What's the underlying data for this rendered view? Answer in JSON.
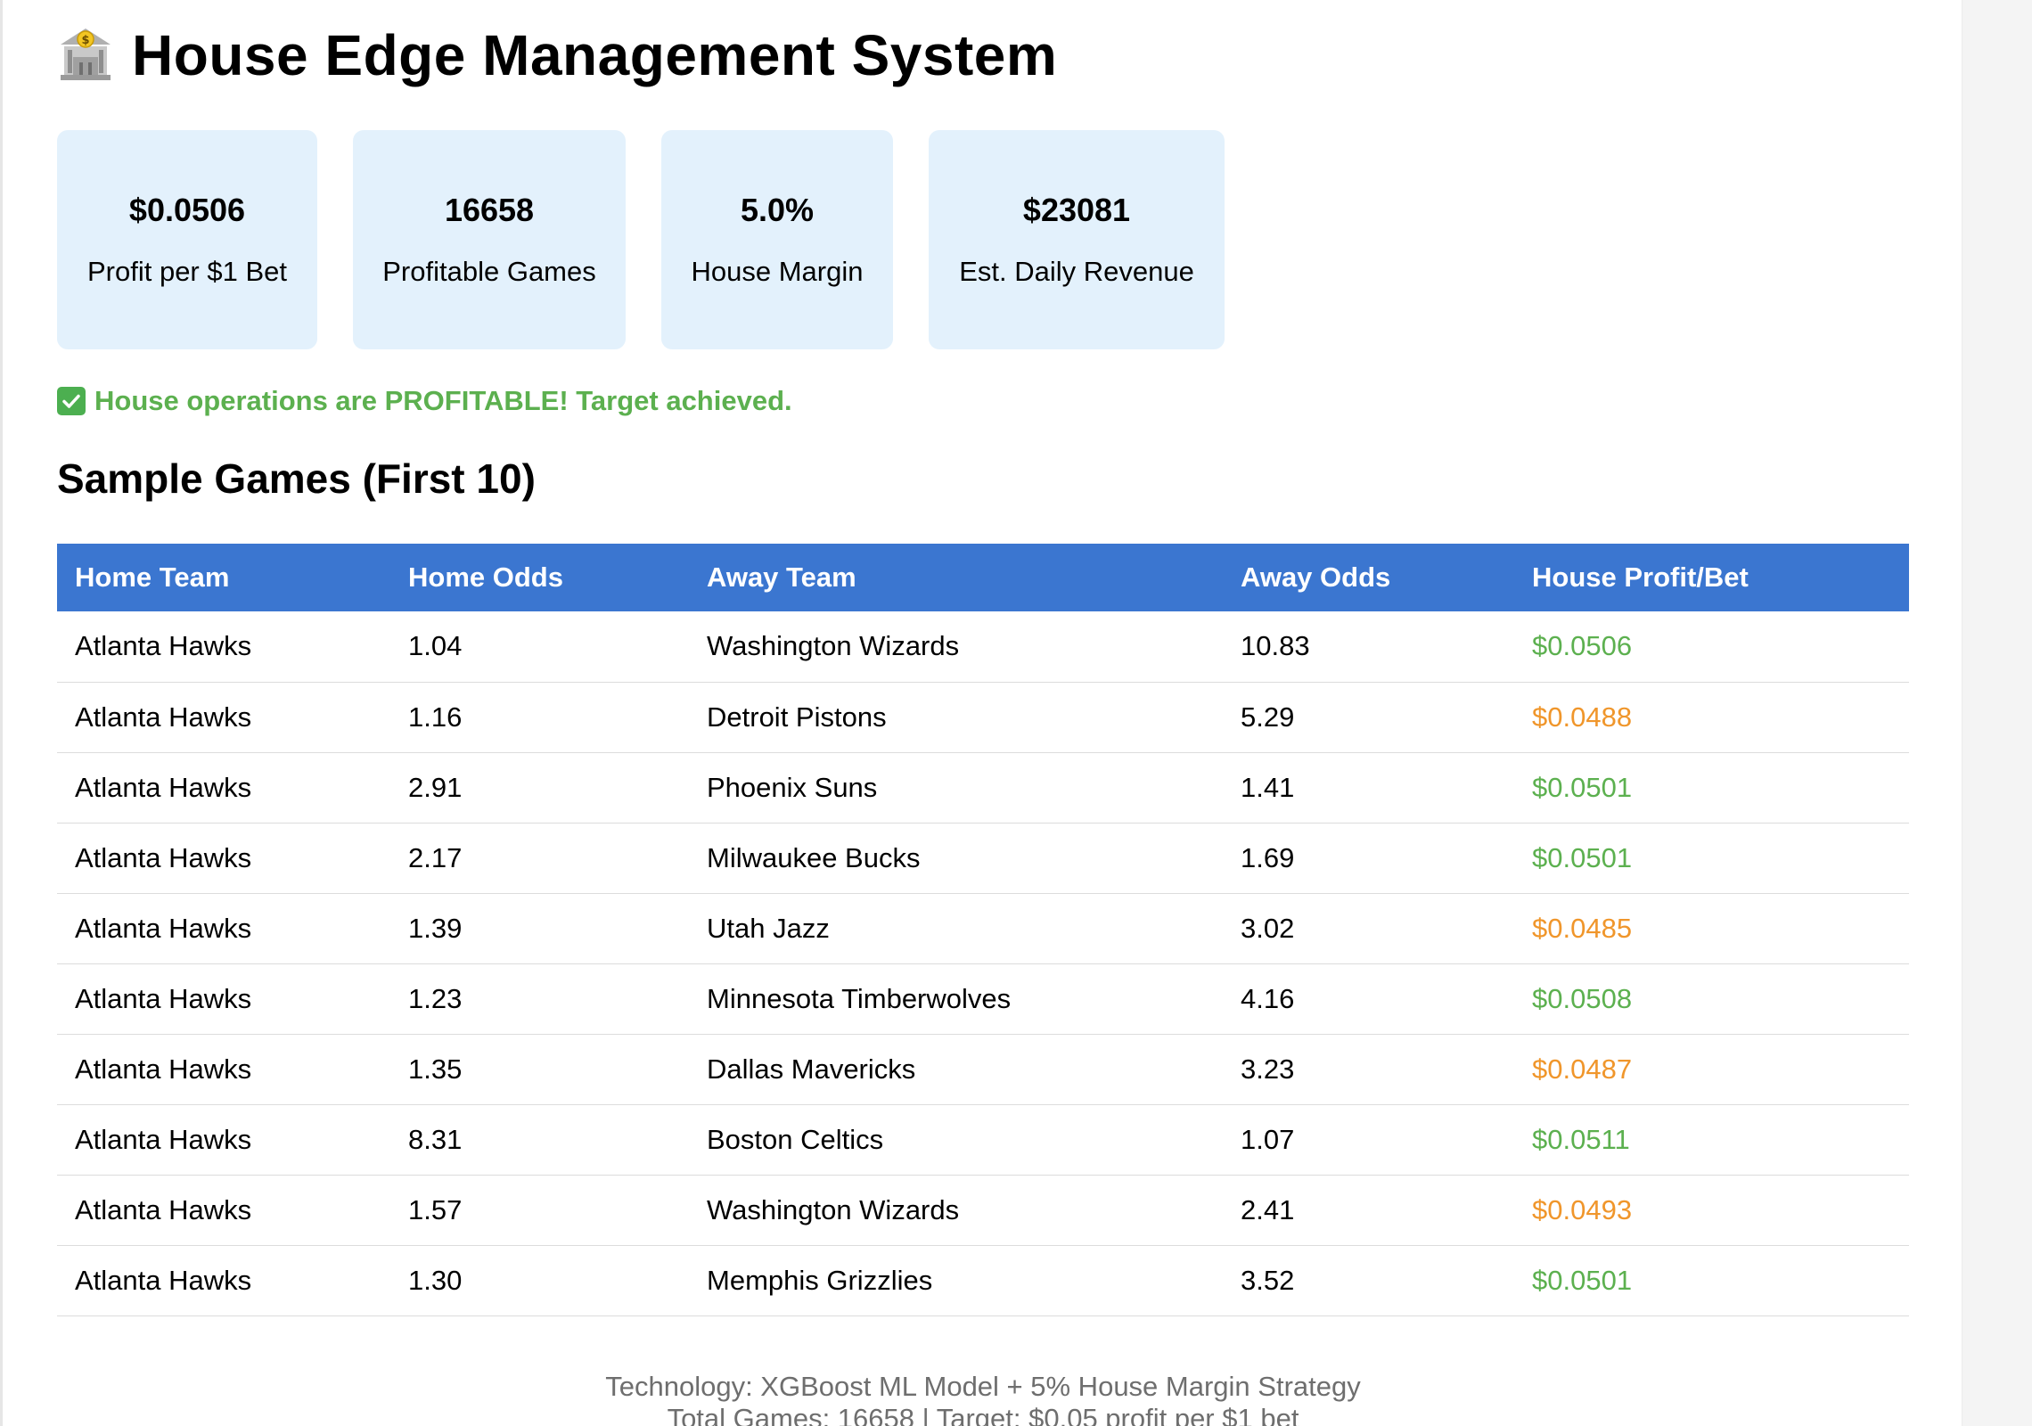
{
  "header": {
    "title": "House Edge Management System",
    "icon": "bank-icon"
  },
  "metrics": [
    {
      "value": "$0.0506",
      "label": "Profit per $1 Bet"
    },
    {
      "value": "16658",
      "label": "Profitable Games"
    },
    {
      "value": "5.0%",
      "label": "House Margin"
    },
    {
      "value": "$23081",
      "label": "Est. Daily Revenue"
    }
  ],
  "status": {
    "icon": "check-mark-icon",
    "text": "House operations are PROFITABLE! Target achieved.",
    "color": "#5cb04f"
  },
  "sample": {
    "title": "Sample Games (First 10)",
    "columns": [
      "Home Team",
      "Home Odds",
      "Away Team",
      "Away Odds",
      "House Profit/Bet"
    ],
    "rows": [
      {
        "home": "Atlanta Hawks",
        "home_odds": "1.04",
        "away": "Washington Wizards",
        "away_odds": "10.83",
        "profit": "$0.0506",
        "profit_status": "good"
      },
      {
        "home": "Atlanta Hawks",
        "home_odds": "1.16",
        "away": "Detroit Pistons",
        "away_odds": "5.29",
        "profit": "$0.0488",
        "profit_status": "warn"
      },
      {
        "home": "Atlanta Hawks",
        "home_odds": "2.91",
        "away": "Phoenix Suns",
        "away_odds": "1.41",
        "profit": "$0.0501",
        "profit_status": "good"
      },
      {
        "home": "Atlanta Hawks",
        "home_odds": "2.17",
        "away": "Milwaukee Bucks",
        "away_odds": "1.69",
        "profit": "$0.0501",
        "profit_status": "good"
      },
      {
        "home": "Atlanta Hawks",
        "home_odds": "1.39",
        "away": "Utah Jazz",
        "away_odds": "3.02",
        "profit": "$0.0485",
        "profit_status": "warn"
      },
      {
        "home": "Atlanta Hawks",
        "home_odds": "1.23",
        "away": "Minnesota Timberwolves",
        "away_odds": "4.16",
        "profit": "$0.0508",
        "profit_status": "good"
      },
      {
        "home": "Atlanta Hawks",
        "home_odds": "1.35",
        "away": "Dallas Mavericks",
        "away_odds": "3.23",
        "profit": "$0.0487",
        "profit_status": "warn"
      },
      {
        "home": "Atlanta Hawks",
        "home_odds": "8.31",
        "away": "Boston Celtics",
        "away_odds": "1.07",
        "profit": "$0.0511",
        "profit_status": "good"
      },
      {
        "home": "Atlanta Hawks",
        "home_odds": "1.57",
        "away": "Washington Wizards",
        "away_odds": "2.41",
        "profit": "$0.0493",
        "profit_status": "warn"
      },
      {
        "home": "Atlanta Hawks",
        "home_odds": "1.30",
        "away": "Memphis Grizzlies",
        "away_odds": "3.52",
        "profit": "$0.0501",
        "profit_status": "good"
      }
    ]
  },
  "colors": {
    "header_bg": "#3b76d0",
    "card_bg": "#e3f1fc",
    "profit_good": "#5cb04f",
    "profit_warn": "#f0962b"
  },
  "footer": {
    "line1": "Technology: XGBoost ML Model + 5% House Margin Strategy",
    "line2": "Total Games: 16658 | Target: $0.05 profit per $1 bet"
  }
}
